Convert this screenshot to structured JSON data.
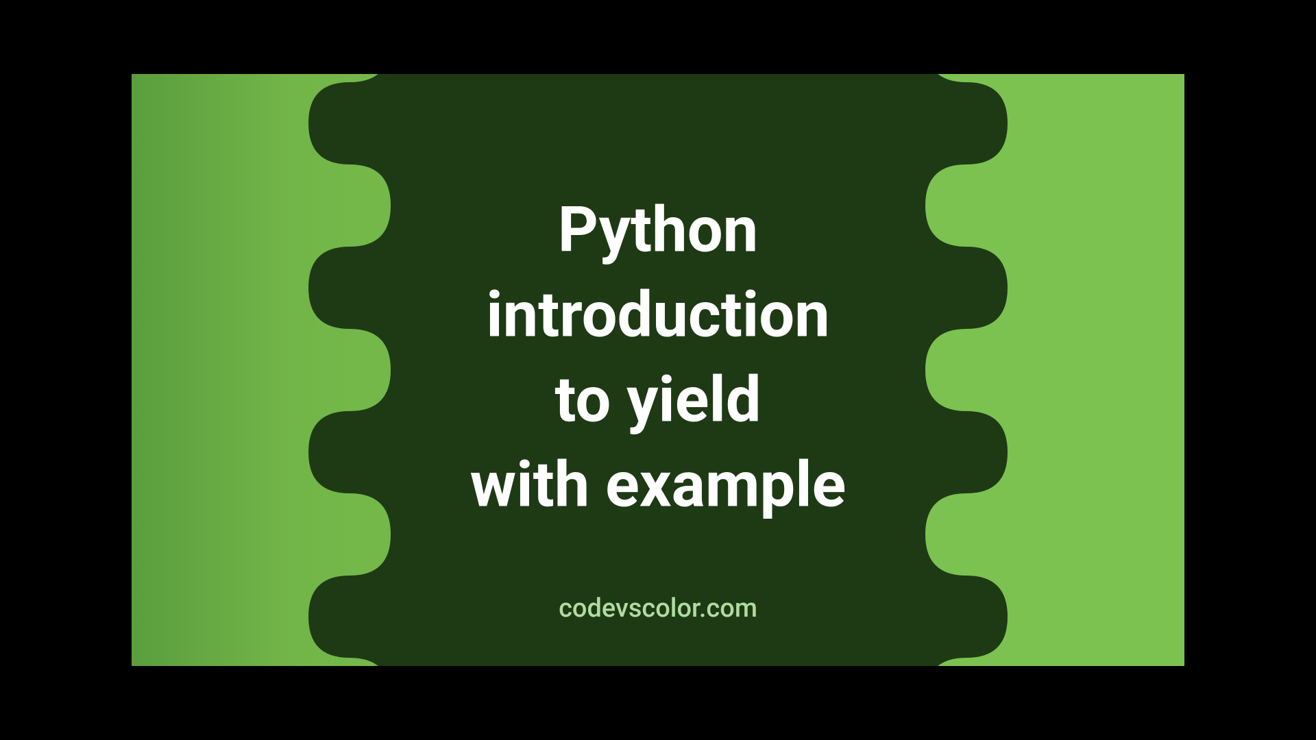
{
  "title": "Python\nintroduction\nto yield\nwith example",
  "footer": "codevscolor.com",
  "colors": {
    "bg_light": "#7cc251",
    "bg_dark": "#1e3a15",
    "text_main": "#ffffff",
    "text_footer": "#b0dca0"
  }
}
